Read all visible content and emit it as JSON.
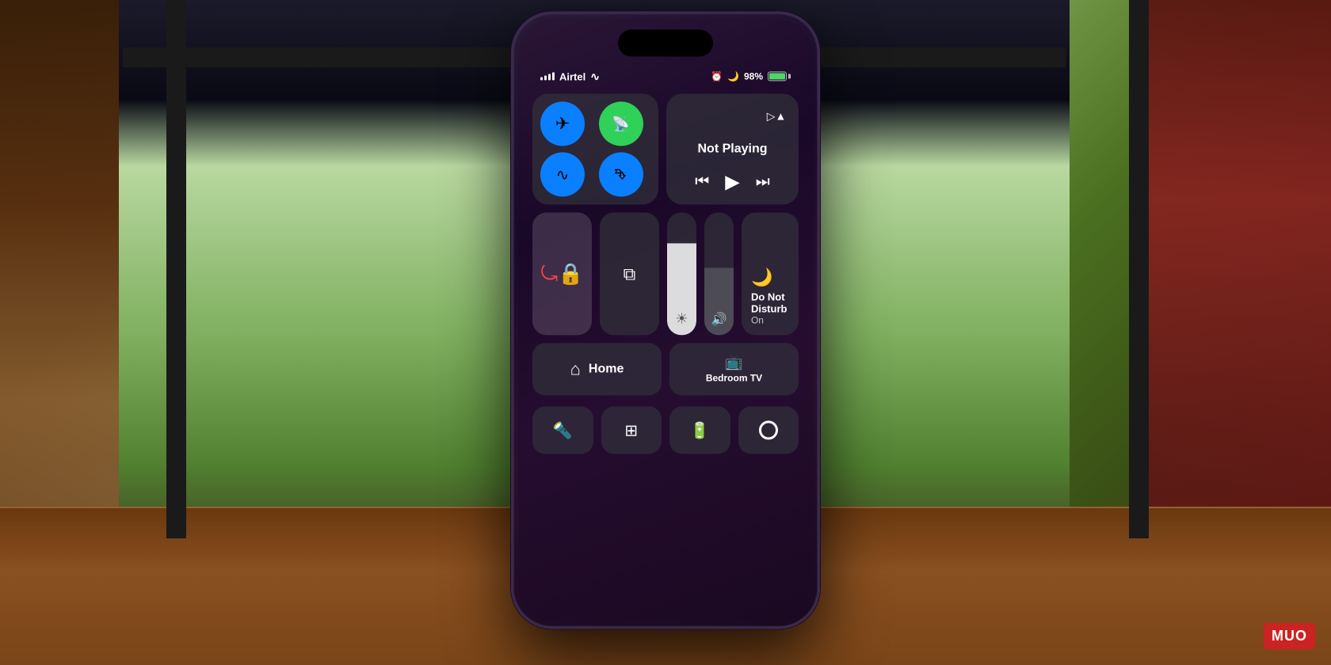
{
  "scene": {
    "brand": "MUO"
  },
  "status_bar": {
    "carrier": "Airtel",
    "battery_percent": "98%",
    "signal_bars": [
      3,
      5,
      8,
      11,
      14
    ]
  },
  "connectivity": {
    "airplane_label": "Airplane Mode",
    "cellular_label": "Cellular",
    "wifi_label": "Wi-Fi",
    "bluetooth_label": "Bluetooth"
  },
  "media": {
    "not_playing": "Not Playing",
    "airplay_label": "AirPlay",
    "rewind_label": "Rewind",
    "play_label": "Play",
    "fast_forward_label": "Fast Forward"
  },
  "quick_controls": {
    "lock_label": "Screen Rotation Lock",
    "mirror_label": "Screen Mirroring",
    "brightness_label": "Brightness",
    "volume_label": "Volume"
  },
  "dnd": {
    "title": "Do Not Disturb",
    "subtitle": "On",
    "icon": "🌙"
  },
  "home": {
    "home_label": "Home",
    "bedroom_tv_label": "Bedroom TV"
  },
  "bottom_controls": {
    "flashlight": "Flashlight",
    "qr_scanner": "QR Scanner",
    "battery_widget": "Battery",
    "screen_record": "Screen Record"
  }
}
